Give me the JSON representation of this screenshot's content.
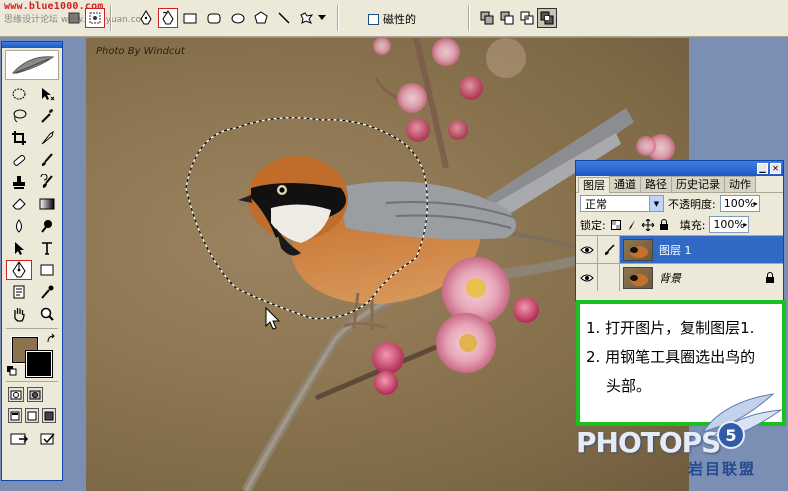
{
  "options_bar": {
    "watermark_url": "www.blue1000.com",
    "watermark_site": "思缘设计论坛 www.missyuan.com",
    "magnetic_label": "磁性的",
    "magnetic_checked": false
  },
  "toolbox": {
    "active_tool": "pen-tool",
    "foreground_color": "#8b7350",
    "background_color": "#000000"
  },
  "canvas": {
    "photo_credit": "Photo By Windcut",
    "has_selection": true
  },
  "layers_palette": {
    "tabs": [
      {
        "label": "图层",
        "active": true
      },
      {
        "label": "通道",
        "active": false
      },
      {
        "label": "路径",
        "active": false
      },
      {
        "label": "历史记录",
        "active": false
      },
      {
        "label": "动作",
        "active": false
      }
    ],
    "blend_mode": "正常",
    "opacity_label": "不透明度:",
    "opacity_value": "100%",
    "lock_label": "锁定:",
    "fill_label": "填充:",
    "fill_value": "100%",
    "layers": [
      {
        "name": "图层 1",
        "selected": true,
        "italic": false
      },
      {
        "name": "背景",
        "selected": false,
        "italic": true
      }
    ]
  },
  "instructions": {
    "line1": "1. 打开图片，复制图层1.",
    "line2": "2. 用钢笔工具圈选出鸟的",
    "line3": "头部。"
  },
  "branding": {
    "photops": "PHOTOPS",
    "cn": "岩目联盟",
    "badge": "5"
  }
}
